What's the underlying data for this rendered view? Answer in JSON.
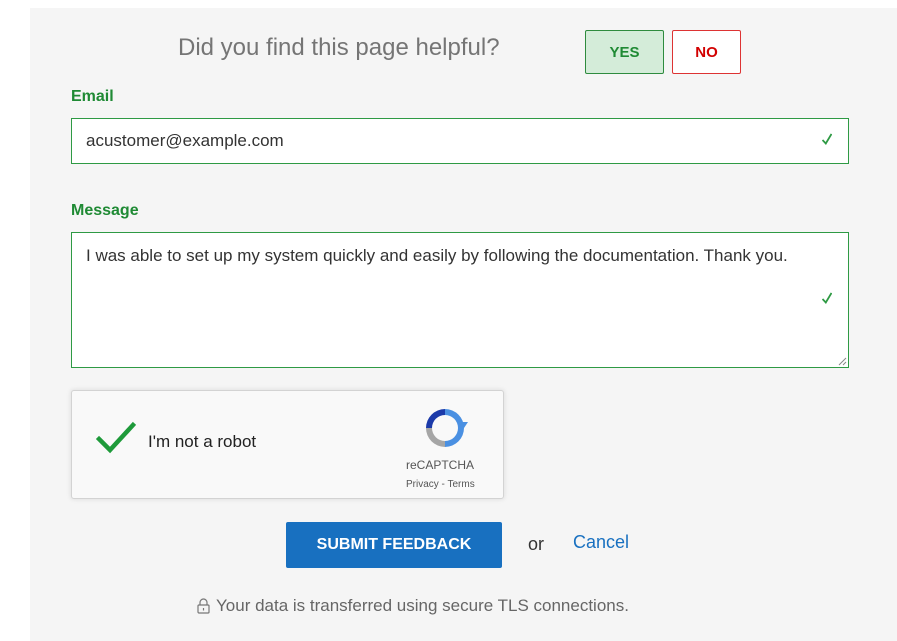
{
  "feedback": {
    "question": "Did you find this page helpful?",
    "yes_label": "YES",
    "no_label": "NO",
    "selected": "YES"
  },
  "email": {
    "label": "Email",
    "value": "acustomer@example.com",
    "valid": true
  },
  "message": {
    "label": "Message",
    "value": "I was able to set up my system quickly and easily by following the documentation. Thank you.",
    "valid": true
  },
  "captcha": {
    "label": "I'm not a robot",
    "checked": true,
    "brand": "reCAPTCHA",
    "links": "Privacy - Terms",
    "icon": "recaptcha-logo-icon"
  },
  "actions": {
    "submit_label": "SUBMIT FEEDBACK",
    "or_text": "or",
    "cancel_label": "Cancel"
  },
  "security": {
    "note": "Your data is transferred using secure TLS connections.",
    "icon": "lock-icon"
  },
  "colors": {
    "accent_green": "#1f8a34",
    "accent_red": "#d20000",
    "primary_blue": "#1870c0",
    "panel_bg": "#f5f5f5"
  }
}
